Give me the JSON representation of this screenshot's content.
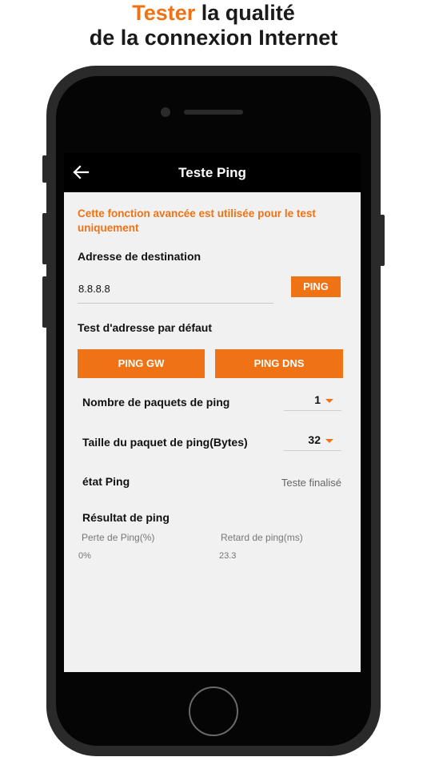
{
  "headline": {
    "accent": "Tester",
    "rest_line1": " la qualité",
    "line2": "de la connexion Internet"
  },
  "appbar": {
    "back_icon": "arrow-left-icon",
    "title": "Teste Ping"
  },
  "notice": "Cette fonction avancée est utilisée pour le test uniquement",
  "destination": {
    "label": "Adresse de destination",
    "value": "8.8.8.8",
    "ping_button": "PING"
  },
  "default_test": {
    "label": "Test d'adresse par défaut",
    "gw_button": "PING GW",
    "dns_button": "PING DNS"
  },
  "packets": {
    "label": "Nombre de paquets de ping",
    "value": "1"
  },
  "packet_size": {
    "label": "Taille du paquet de ping(Bytes)",
    "value": "32"
  },
  "state": {
    "label": "état Ping",
    "value": "Teste finalisé"
  },
  "result": {
    "label": "Résultat de ping",
    "loss_header": "Perte de Ping(%)",
    "delay_header": "Retard de ping(ms)",
    "loss_value": "0%",
    "delay_value": "23.3"
  },
  "colors": {
    "accent": "#ef7215",
    "appbar": "#000000",
    "screen_bg": "#f1f1f1"
  }
}
